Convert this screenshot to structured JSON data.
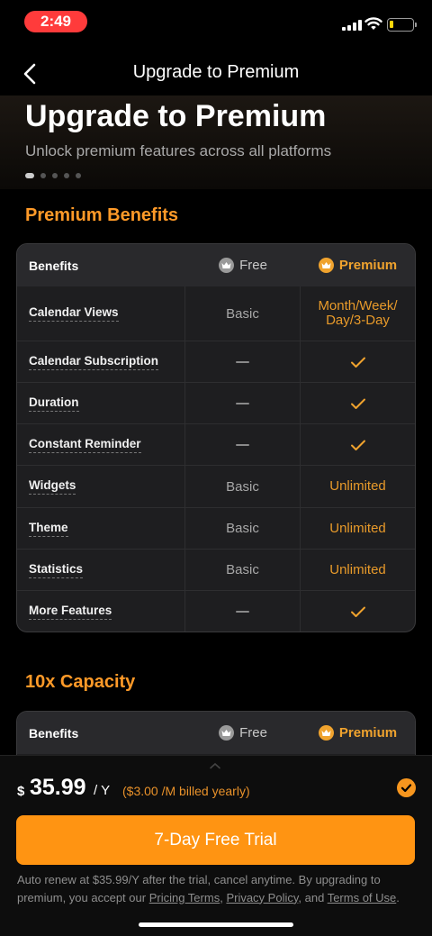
{
  "status_bar": {
    "time": "2:49"
  },
  "nav": {
    "title": "Upgrade to Premium"
  },
  "hero": {
    "title": "Upgrade to Premium",
    "subtitle": "Unlock premium features across all platforms"
  },
  "sections": {
    "benefits_title": "Premium Benefits",
    "capacity_title": "10x Capacity"
  },
  "table": {
    "header": {
      "benefits": "Benefits",
      "free": "Free",
      "premium": "Premium"
    },
    "rows": [
      {
        "label": "Calendar Views",
        "free": "Basic",
        "premium": "Month/Week/\nDay/3-Day"
      },
      {
        "label": "Calendar Subscription",
        "free": "dash",
        "premium": "check"
      },
      {
        "label": "Duration",
        "free": "dash",
        "premium": "check"
      },
      {
        "label": "Constant Reminder",
        "free": "dash",
        "premium": "check"
      },
      {
        "label": "Widgets",
        "free": "Basic",
        "premium": "Unlimited"
      },
      {
        "label": "Theme",
        "free": "Basic",
        "premium": "Unlimited"
      },
      {
        "label": "Statistics",
        "free": "Basic",
        "premium": "Unlimited"
      },
      {
        "label": "More Features",
        "free": "dash",
        "premium": "check"
      }
    ]
  },
  "capacity_table": {
    "header": {
      "benefits": "Benefits",
      "free": "Free",
      "premium": "Premium"
    }
  },
  "purchase": {
    "currency": "$",
    "amount": "35.99",
    "period": "/ Y",
    "monthly_note": "($3.00 /M billed yearly)",
    "selected": true,
    "cta": "7-Day Free Trial",
    "legal_prefix": "Auto renew at $35.99/Y after the trial, cancel anytime. By upgrading to premium, you accept our ",
    "pricing_terms": "Pricing Terms",
    "comma": ", ",
    "privacy_policy": "Privacy Policy",
    "and": ", and ",
    "terms_of_use": "Terms of Use",
    "period_end": "."
  },
  "colors": {
    "accent": "#ff9412",
    "accent_text": "#f0a32e",
    "background": "#000000",
    "status_time_pill": "#ff3b3b"
  },
  "icons": [
    "back-chevron-icon",
    "crown-icon",
    "check-icon",
    "dash-icon",
    "chevron-up-icon",
    "checkmark-circle-icon",
    "wifi-icon",
    "signal-icon",
    "battery-icon"
  ]
}
